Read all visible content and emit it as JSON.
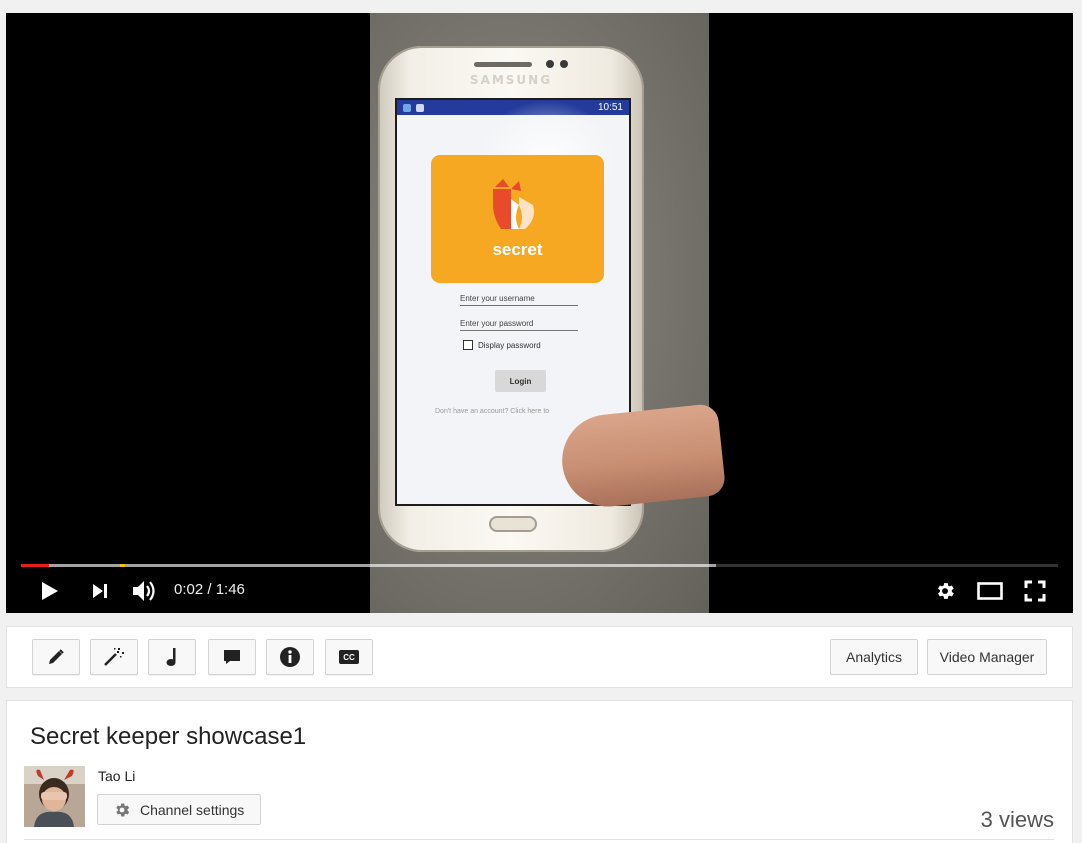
{
  "video": {
    "phone_brand": "SAMSUNG",
    "status_time": "10:51",
    "app_logo_text": "secret",
    "username_placeholder": "Enter your username",
    "password_placeholder": "Enter your password",
    "display_password_label": "Display password",
    "login_label": "Login",
    "signup_text": "Don't have an account? Click here to"
  },
  "player": {
    "current_time": "0:02",
    "separator": "/",
    "duration": "1:46",
    "time_display": "0:02 / 1:46",
    "played_fraction": 0.027,
    "buffered_fraction": 0.67,
    "marker_fraction": 0.095,
    "colors": {
      "played": "#e62117",
      "marker": "#f4c20d"
    },
    "icons": [
      "play-icon",
      "next-icon",
      "volume-icon",
      "settings-gear-icon",
      "theater-mode-icon",
      "fullscreen-icon"
    ]
  },
  "toolbar": {
    "icons": [
      "pencil-icon",
      "magic-wand-icon",
      "music-note-icon",
      "comment-icon",
      "info-icon",
      "cc-icon"
    ],
    "cc_text": "CC",
    "analytics_label": "Analytics",
    "video_manager_label": "Video Manager"
  },
  "info": {
    "title": "Secret keeper showcase1",
    "owner_name": "Tao Li",
    "channel_settings_label": "Channel settings",
    "views": "3 views"
  }
}
